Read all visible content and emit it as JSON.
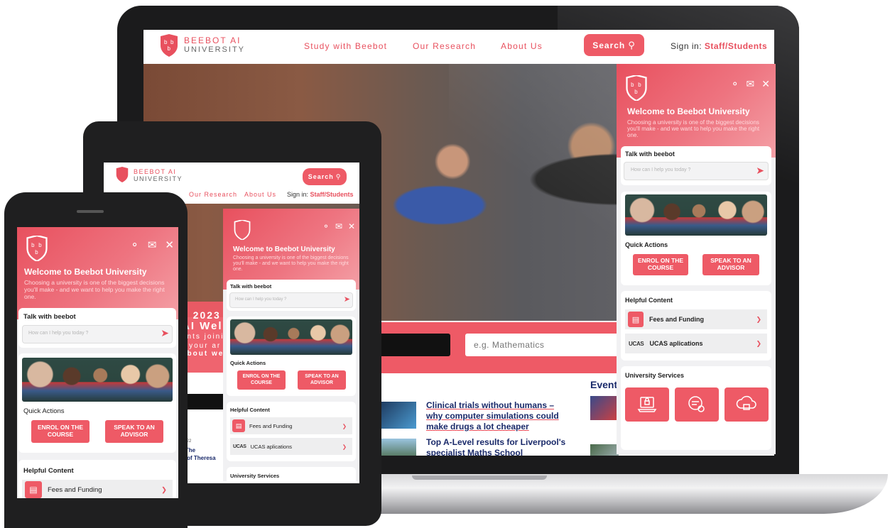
{
  "brand": {
    "line1": "BEEBOT AI",
    "line2": "UNIVERSITY"
  },
  "nav": {
    "study": "Study with Beebot",
    "research": "Our Research",
    "about": "About Us",
    "search": "Search",
    "signin_prefix": "Sign in:",
    "signin_link": "Staff/Students"
  },
  "hero": {
    "search_placeholder": "e.g. Mathematics",
    "tablet_line1": "k 2023",
    "tablet_line2": "AI Wel",
    "tablet_line3": "ents joini",
    "tablet_line4": "r your ar",
    "tablet_line5": "about we"
  },
  "news": [
    {
      "title": "Clinical trials without humans – why computer simulations could make drugs a lot cheaper"
    },
    {
      "title": "Top A-Level results for Liverpool's specialist Maths School"
    }
  ],
  "events_heading": "Event",
  "tablet_news": {
    "date": "2022",
    "title_line1": ": The",
    "title_line2": "p of Theresa"
  },
  "widget": {
    "title": "Welcome to Beebot University",
    "subtitle": "Choosing a university is one of the biggest decisions you'll make - and we want to help you make the right one.",
    "talk_title": "Talk with beebot",
    "input_placeholder": "How can I help you today ?",
    "quick_actions": "Quick Actions",
    "enrol": "ENROL ON THE COURSE",
    "advisor": "SPEAK TO AN ADVISOR",
    "helpful": "Helpful Content",
    "fees": "Fees and Funding",
    "ucas_logo": "UCAS",
    "ucas": "UCAS aplications",
    "services": "University Services"
  },
  "colors": {
    "accent": "#e8505e",
    "accent_light": "#f4a0a6",
    "nav_text": "#e8505e",
    "dark_bar": "#111111"
  }
}
